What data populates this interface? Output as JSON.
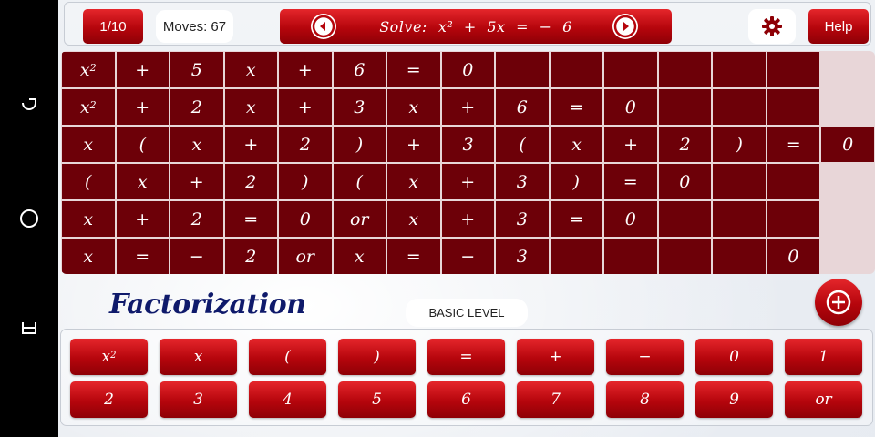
{
  "android_nav": {
    "icons": [
      "recent-apps-icon",
      "home-icon",
      "back-icon"
    ]
  },
  "header": {
    "counter": "1/10",
    "moves": "Moves: 67",
    "problem_label": "Solve:",
    "problem_equation": "x² + 5x = − 6",
    "help_label": "Help"
  },
  "grid": {
    "columns": 14,
    "rows": [
      [
        "x²",
        "+",
        "5",
        "x",
        "+",
        "6",
        "=",
        "0",
        "",
        "",
        "",
        "",
        "",
        ""
      ],
      [
        "x²",
        "+",
        "2",
        "x",
        "+",
        "3",
        "x",
        "+",
        "6",
        "=",
        "0",
        "",
        "",
        ""
      ],
      [
        "x",
        "(",
        "x",
        "+",
        "2",
        ")",
        "+",
        "3",
        "(",
        "x",
        "+",
        "2",
        ")",
        "=",
        "0"
      ],
      [
        "(",
        "x",
        "+",
        "2",
        ")",
        "(",
        "x",
        "+",
        "3",
        ")",
        "=",
        "0",
        "",
        ""
      ],
      [
        "x",
        "+",
        "2",
        "=",
        "0",
        "or",
        "x",
        "+",
        "3",
        "=",
        "0",
        "",
        "",
        ""
      ],
      [
        "x",
        "=",
        "−",
        "2",
        "or",
        "x",
        "=",
        "−",
        "3",
        "",
        "",
        "",
        "",
        "0"
      ]
    ]
  },
  "section": {
    "title": "Factorization",
    "level": "BASIC LEVEL"
  },
  "keypad": {
    "rows": [
      [
        "x²",
        "x",
        "(",
        ")",
        "=",
        "+",
        "−",
        "0",
        "1"
      ],
      [
        "2",
        "3",
        "4",
        "5",
        "6",
        "7",
        "8",
        "9",
        "or"
      ]
    ]
  },
  "colors": {
    "grid_cell": "#6d0008",
    "button_red_top": "#e5262b",
    "button_red_bottom": "#8e0006",
    "title": "#0f1a6b"
  }
}
